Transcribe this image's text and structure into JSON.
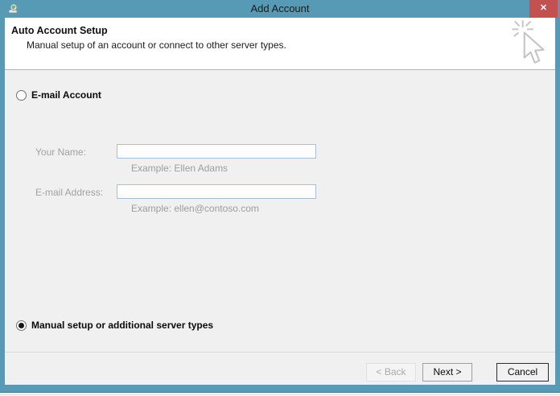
{
  "window": {
    "title": "Add Account",
    "close_glyph": "✕"
  },
  "header": {
    "title": "Auto Account Setup",
    "subtitle": "Manual setup of an account or connect to other server types."
  },
  "options": {
    "email_account": {
      "label": "E-mail Account",
      "selected": false
    },
    "manual_setup": {
      "label": "Manual setup or additional server types",
      "selected": true
    }
  },
  "fields": {
    "your_name": {
      "label": "Your Name:",
      "value": "",
      "example": "Example: Ellen Adams"
    },
    "email_address": {
      "label": "E-mail Address:",
      "value": "",
      "example": "Example: ellen@contoso.com"
    }
  },
  "buttons": {
    "back": "< Back",
    "next": "Next >",
    "cancel": "Cancel"
  },
  "icons": {
    "titlebar_app": "mail-setup-app-icon",
    "header_art": "click-cursor-starburst-icon"
  },
  "colors": {
    "titlebar": "#579ab5",
    "close_button": "#c25152",
    "body": "#f0f0f0",
    "header_background": "#ffffff",
    "input_border": "#aabfd5",
    "disabled_text": "#a2a2a2"
  }
}
